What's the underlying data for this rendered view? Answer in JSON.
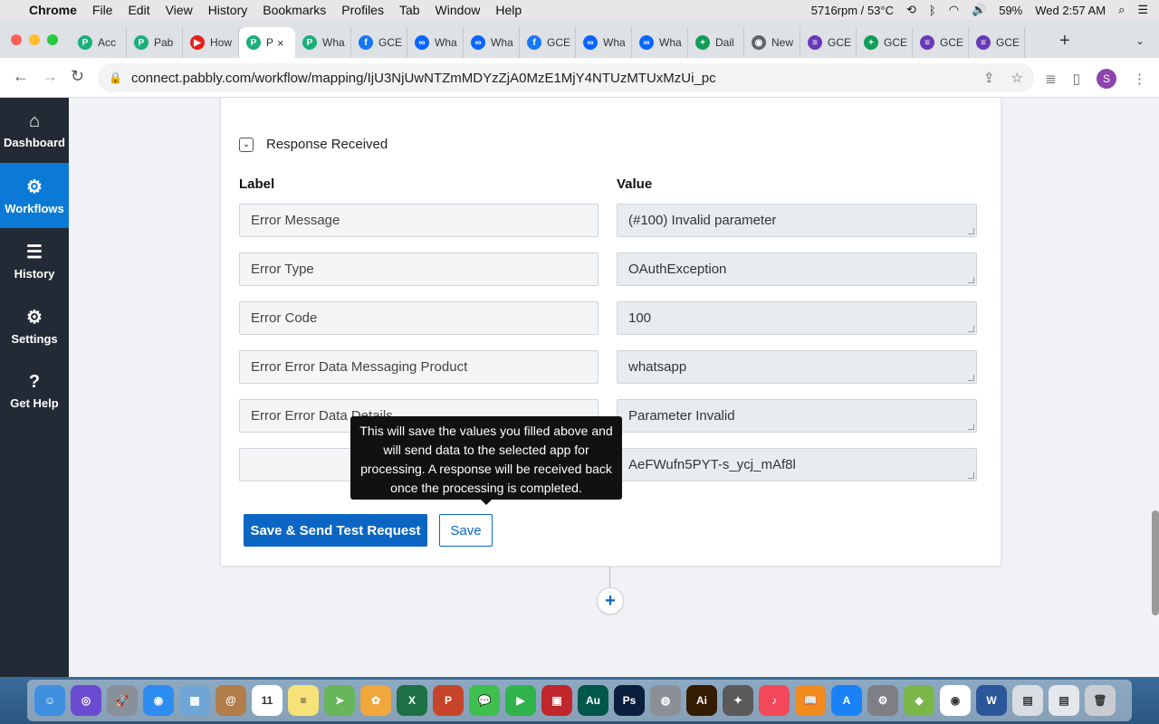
{
  "menubar": {
    "app": "Chrome",
    "items": [
      "File",
      "Edit",
      "View",
      "History",
      "Bookmarks",
      "Profiles",
      "Tab",
      "Window",
      "Help"
    ],
    "status": {
      "fan": "5716rpm / 53°C",
      "battery": "59%",
      "clock": "Wed 2:57 AM"
    }
  },
  "tabs": [
    {
      "label": "Acc",
      "color": "#1aaf7a",
      "glyph": "P"
    },
    {
      "label": "Pab",
      "color": "#1aaf7a",
      "glyph": "P"
    },
    {
      "label": "How",
      "color": "#e62117",
      "glyph": "▶"
    },
    {
      "label": "P",
      "color": "#1aaf7a",
      "glyph": "P",
      "active": true
    },
    {
      "label": "Wha",
      "color": "#1aaf7a",
      "glyph": "P"
    },
    {
      "label": "GCE",
      "color": "#1877f2",
      "glyph": "f"
    },
    {
      "label": "Wha",
      "color": "#0866ff",
      "glyph": "∞"
    },
    {
      "label": "Wha",
      "color": "#0866ff",
      "glyph": "∞"
    },
    {
      "label": "GCE",
      "color": "#1877f2",
      "glyph": "f"
    },
    {
      "label": "Wha",
      "color": "#0866ff",
      "glyph": "∞"
    },
    {
      "label": "Wha",
      "color": "#0866ff",
      "glyph": "∞"
    },
    {
      "label": "Dail",
      "color": "#0f9d58",
      "glyph": "+"
    },
    {
      "label": "New",
      "color": "#5f6368",
      "glyph": "◉"
    },
    {
      "label": "GCE",
      "color": "#673ab7",
      "glyph": "≡"
    },
    {
      "label": "GCE",
      "color": "#0f9d58",
      "glyph": "+"
    },
    {
      "label": "GCE",
      "color": "#673ab7",
      "glyph": "≡"
    },
    {
      "label": "GCE",
      "color": "#673ab7",
      "glyph": "≡"
    }
  ],
  "url": "connect.pabbly.com/workflow/mapping/IjU3NjUwNTZmMDYzZjA0MzE1MjY4NTUzMTUxMzUi_pc",
  "profile_initial": "S",
  "sidebar": [
    {
      "label": "Dashboard",
      "icon": "⌂"
    },
    {
      "label": "Workflows",
      "icon": "⚙",
      "active": true
    },
    {
      "label": "History",
      "icon": "☰"
    },
    {
      "label": "Settings",
      "icon": "⚙"
    },
    {
      "label": "Get Help",
      "icon": "?"
    }
  ],
  "response": {
    "title": "Response Received",
    "label_header": "Label",
    "value_header": "Value",
    "rows": [
      {
        "label": "Error Message",
        "value": "(#100) Invalid parameter"
      },
      {
        "label": "Error Type",
        "value": "OAuthException"
      },
      {
        "label": "Error Code",
        "value": "100"
      },
      {
        "label": "Error Error Data Messaging Product",
        "value": "whatsapp"
      },
      {
        "label": "Error Error Data Details",
        "value": "Parameter Invalid"
      },
      {
        "label": "",
        "value": "AeFWufn5PYT-s_ycj_mAf8l"
      }
    ]
  },
  "buttons": {
    "send": "Save & Send Test Request",
    "save": "Save"
  },
  "tooltip": "This will save the values you filled above and will send data to the selected app for processing. A response will be received back once the processing is completed.",
  "add_step": "+",
  "dock": [
    {
      "name": "finder",
      "color": "#3f8fe0",
      "glyph": "☺"
    },
    {
      "name": "siri",
      "color": "#6b4bd1",
      "glyph": "◎"
    },
    {
      "name": "launchpad",
      "color": "#8a9099",
      "glyph": "🚀"
    },
    {
      "name": "safari",
      "color": "#2d8cf0",
      "glyph": "◉"
    },
    {
      "name": "preview",
      "color": "#6fa6d6",
      "glyph": "▦"
    },
    {
      "name": "contacts",
      "color": "#b07d4b",
      "glyph": "@"
    },
    {
      "name": "calendar",
      "color": "#ffffff",
      "glyph": "11"
    },
    {
      "name": "notes",
      "color": "#f7e27a",
      "glyph": "≡"
    },
    {
      "name": "maps",
      "color": "#67b75a",
      "glyph": "➤"
    },
    {
      "name": "photos",
      "color": "#f0a73c",
      "glyph": "✿"
    },
    {
      "name": "excel",
      "color": "#1d7044",
      "glyph": "X"
    },
    {
      "name": "powerpoint",
      "color": "#c6452a",
      "glyph": "P"
    },
    {
      "name": "messages",
      "color": "#3fbf4e",
      "glyph": "💬"
    },
    {
      "name": "facetime",
      "color": "#2fb34a",
      "glyph": "▶"
    },
    {
      "name": "photo-booth",
      "color": "#c0262b",
      "glyph": "▣"
    },
    {
      "name": "audition",
      "color": "#00584a",
      "glyph": "Au"
    },
    {
      "name": "photoshop",
      "color": "#0b1e3d",
      "glyph": "Ps"
    },
    {
      "name": "disk-utility",
      "color": "#8b8f96",
      "glyph": "◍"
    },
    {
      "name": "illustrator",
      "color": "#331c00",
      "glyph": "Ai"
    },
    {
      "name": "final-cut",
      "color": "#5a5a5a",
      "glyph": "✦"
    },
    {
      "name": "music",
      "color": "#f2485a",
      "glyph": "♪"
    },
    {
      "name": "books",
      "color": "#f28b1e",
      "glyph": "📖"
    },
    {
      "name": "app-store",
      "color": "#1a82f7",
      "glyph": "A"
    },
    {
      "name": "system-preferences",
      "color": "#7d7f84",
      "glyph": "⚙"
    },
    {
      "name": "android-studio",
      "color": "#7ab648",
      "glyph": "◆"
    },
    {
      "name": "chrome",
      "color": "#ffffff",
      "glyph": "◉"
    },
    {
      "name": "word",
      "color": "#2b579a",
      "glyph": "W"
    },
    {
      "name": "downloads",
      "color": "#d8dde3",
      "glyph": "▤"
    },
    {
      "name": "documents",
      "color": "#e4e8ec",
      "glyph": "▤"
    },
    {
      "name": "trash",
      "color": "#c9cdd2",
      "glyph": "🗑"
    }
  ]
}
